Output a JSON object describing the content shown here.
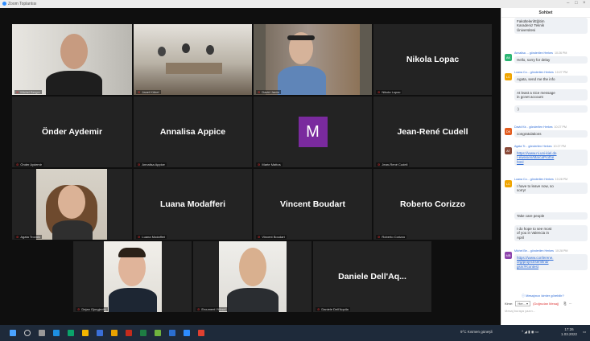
{
  "window": {
    "title": "Zoom Toplantısı"
  },
  "participants": [
    {
      "id": "p1",
      "label": "Michel Berger"
    },
    {
      "id": "p2",
      "label": "Janet Köbel"
    },
    {
      "id": "p3",
      "label": "David Jarda"
    },
    {
      "id": "p4",
      "display": "Nikola Lopac",
      "label": "Nikola Lopac"
    },
    {
      "id": "p5",
      "display": "Önder Aydemir",
      "label": "Önder Aydemir"
    },
    {
      "id": "p6",
      "display": "Annalisa Appice",
      "label": "Annalisa Appice"
    },
    {
      "id": "p7",
      "initial": "M",
      "label": "Marte Mattos"
    },
    {
      "id": "p8",
      "display": "Jean-René Cudell",
      "label": "Jean-René Cudell"
    },
    {
      "id": "p9",
      "label": "Agata Trovato"
    },
    {
      "id": "p10",
      "display": "Luana Modafferi",
      "label": "Luana Modafferi"
    },
    {
      "id": "p11",
      "display": "Vincent Boudart",
      "label": "Vincent Boudart"
    },
    {
      "id": "p12",
      "display": "Roberto Corizzo",
      "label": "Roberto Corizzo"
    },
    {
      "id": "p13",
      "label": "Dejan Gjorgjevikj"
    },
    {
      "id": "p14",
      "label": "Ercument Yüksel"
    },
    {
      "id": "p15",
      "display": "Daniele Dell'Aq...",
      "label": "Daniele Dell'Aquila"
    }
  ],
  "chat": {
    "header": "Sohbet",
    "messages": [
      {
        "av": "",
        "avcolor": "#ffffff",
        "meta": "",
        "time": "",
        "lines": [
          "Fakülteleri/Eğitim",
          "Karadeniz Teknik",
          "Üniversitesi"
        ],
        "link": false
      },
      {
        "av": "AK",
        "avcolor": "#2bb673",
        "meta": "Annalisa ... gönderilen Herkes",
        "time": "10:26 PM",
        "lines": [
          "Hello, sorry for delay"
        ],
        "link": false
      },
      {
        "av": "LC",
        "avcolor": "#f0a500",
        "meta": "Luana Co... gönderilen Herkes",
        "time": "10:27 PM",
        "lines": [
          "Agata, send me the info"
        ],
        "link": false
      },
      {
        "av": "",
        "avcolor": "#ffffff",
        "meta": "",
        "time": "",
        "lines": [
          "At least a nice message",
          "in gcnet account"
        ],
        "link": false
      },
      {
        "av": "",
        "avcolor": "#ffffff",
        "meta": "",
        "time": "",
        "lines": [
          ":)"
        ],
        "link": false
      },
      {
        "av": "DK",
        "avcolor": "#e35d20",
        "meta": "David Kir... gönderilen Herkes",
        "time": "10:27 PM",
        "lines": [
          "congratulations"
        ],
        "link": false
      },
      {
        "av": "AT",
        "avcolor": "#8a4b3a",
        "meta": "Agata Tr... gönderilen Herkes",
        "time": "10:27 PM",
        "lines": [
          "https://www.ni.uni-kiel.de",
          "/-eweisen/MarcaProthe",
          "html"
        ],
        "link": true
      },
      {
        "av": "LC",
        "avcolor": "#f0a500",
        "meta": "Luana Co... gönderilen Herkes",
        "time": "10:28 PM",
        "lines": [
          "I have to leave now, so",
          "sorry!"
        ],
        "link": false
      },
      {
        "av": "",
        "avcolor": "#ffffff",
        "meta": "",
        "time": "",
        "lines": [
          "Take care people"
        ],
        "link": false
      },
      {
        "av": "",
        "avcolor": "#ffffff",
        "meta": "",
        "time": "",
        "lines": [
          "I do hope to see most",
          "of you in Valencia in",
          "April"
        ],
        "link": false
      },
      {
        "av": "MB",
        "avcolor": "#8e44ad",
        "meta": "Michel Be... gönderilen Herkes",
        "time": "10:28 PM",
        "lines": [
          "https://www.conferene.",
          "org/project/semfina/",
          "gsnr/#contest"
        ],
        "link": true
      }
    ],
    "who_can_see": "Mesajınızı kimler görebilir?",
    "send_to_label": "Kime:",
    "send_to_value": "Her...",
    "direct_msg": "(Doğrudan Mesaj)",
    "input_placeholder": "Mesaj buraya yazın..."
  },
  "taskbar": {
    "weather": "9°C  Kısmen güneşli",
    "time": "17:26",
    "date": "1.03.2022"
  }
}
